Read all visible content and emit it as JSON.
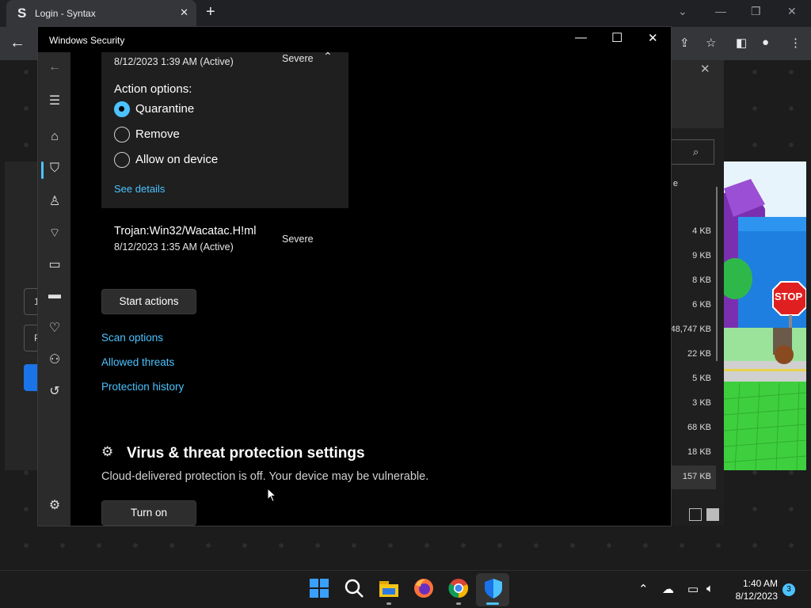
{
  "browser": {
    "tab_favicon": "S",
    "tab_title": "Login - Syntax",
    "tab_close": "✕",
    "new_tab": "+",
    "toolbar_icons": [
      "share-icon",
      "star-icon",
      "sidebar-icon",
      "profile-icon",
      "menu-icon"
    ]
  },
  "background_app": {
    "left_box_1": "1",
    "left_box_2": "P",
    "sizes": [
      "4 KB",
      "9 KB",
      "8 KB",
      "6 KB",
      "48,747 KB",
      "22 KB",
      "5 KB",
      "3 KB",
      "68 KB",
      "18 KB",
      "157 KB"
    ],
    "partial_header": "e"
  },
  "window": {
    "title": "Windows Security",
    "minimize": "—",
    "maximize": "☐",
    "close": "✕"
  },
  "sidebar": {
    "items": [
      "back-icon",
      "hamburger-icon",
      "home-icon",
      "shield-icon",
      "account-icon",
      "network-icon",
      "app-browser-icon",
      "device-security-icon",
      "health-icon",
      "family-icon",
      "history-icon",
      "settings-icon"
    ]
  },
  "threat1": {
    "date": "8/12/2023 1:39 AM (Active)",
    "severity": "Severe",
    "action_label": "Action options:",
    "options": [
      "Quarantine",
      "Remove",
      "Allow on device"
    ],
    "selected": "Quarantine",
    "see_details": "See details"
  },
  "threat2": {
    "name": "Trojan:Win32/Wacatac.H!ml",
    "date": "8/12/2023 1:35 AM (Active)",
    "severity": "Severe"
  },
  "actions": {
    "start_actions": "Start actions",
    "scan_options": "Scan options",
    "allowed_threats": "Allowed threats",
    "protection_history": "Protection history"
  },
  "settings_section": {
    "title": "Virus & threat protection settings",
    "description": "Cloud-delivered protection is off. Your device may be vulnerable.",
    "turn_on": "Turn on"
  },
  "game": {
    "stop_sign": "STOP"
  },
  "taskbar": {
    "apps": [
      "windows-start",
      "search",
      "file-explorer",
      "firefox",
      "chrome",
      "windows-security"
    ],
    "time": "1:40 AM",
    "date": "8/12/2023",
    "notifications": "3"
  },
  "colors": {
    "accent": "#4cc2ff",
    "window_bg": "#000000",
    "sidebar_bg": "#2b2b2b",
    "card_bg": "#1f1f1f"
  }
}
